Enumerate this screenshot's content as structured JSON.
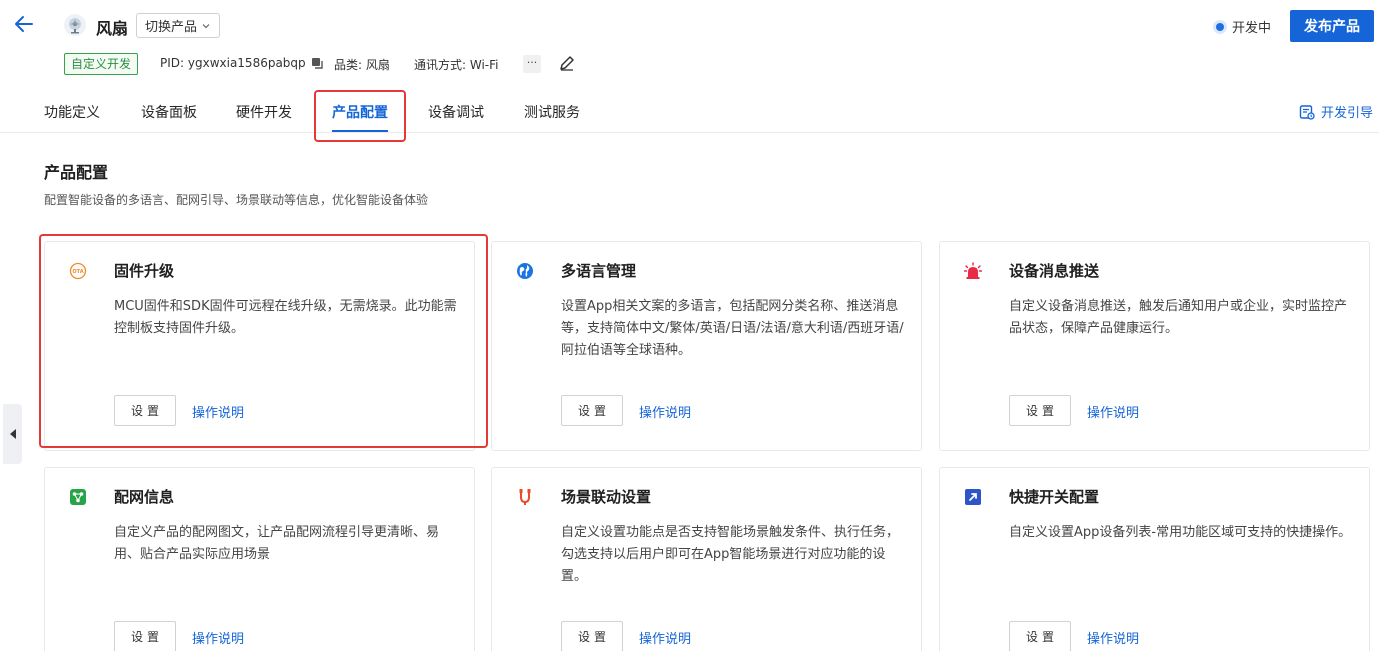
{
  "header": {
    "product_name": "风扇",
    "switch_label": "切换产品",
    "status": "开发中",
    "publish_label": "发布产品",
    "tag": "自定义开发",
    "pid": "PID: ygxwxia1586pabqp",
    "category": "品类: 风扇",
    "comm": "通讯方式: Wi-Fi",
    "more": "···",
    "colors": {
      "primary": "#1565d8",
      "tag_green": "#2c8f3f",
      "highlight": "#e53935"
    }
  },
  "tabs": [
    {
      "label": "功能定义"
    },
    {
      "label": "设备面板"
    },
    {
      "label": "硬件开发"
    },
    {
      "label": "产品配置"
    },
    {
      "label": "设备调试"
    },
    {
      "label": "测试服务"
    }
  ],
  "active_tab": "产品配置",
  "dev_guide": "开发引导",
  "section": {
    "title": "产品配置",
    "desc": "配置智能设备的多语言、配网引导、场景联动等信息，优化智能设备体验"
  },
  "cards": [
    {
      "icon": "ota-icon",
      "title": "固件升级",
      "desc": "MCU固件和SDK固件可远程在线升级，无需烧录。此功能需控制板支持固件升级。",
      "set": "设置",
      "help": "操作说明"
    },
    {
      "icon": "globe-icon",
      "title": "多语言管理",
      "desc": "设置App相关文案的多语言，包括配网分类名称、推送消息等，支持简体中文/繁体/英语/日语/法语/意大利语/西班牙语/阿拉伯语等全球语种。",
      "set": "设置",
      "help": "操作说明"
    },
    {
      "icon": "alarm-icon",
      "title": "设备消息推送",
      "desc": "自定义设备消息推送，触发后通知用户或企业，实时监控产品状态，保障产品健康运行。",
      "set": "设置",
      "help": "操作说明"
    },
    {
      "icon": "network-icon",
      "title": "配网信息",
      "desc": "自定义产品的配网图文，让产品配网流程引导更清晰、易用、贴合产品实际应用场景",
      "set": "设置",
      "help": "操作说明"
    },
    {
      "icon": "scene-icon",
      "title": "场景联动设置",
      "desc": "自定义设置功能点是否支持智能场景触发条件、执行任务，勾选支持以后用户即可在App智能场景进行对应功能的设置。",
      "set": "设置",
      "help": "操作说明"
    },
    {
      "icon": "shortcut-icon",
      "title": "快捷开关配置",
      "desc": "自定义设置App设备列表-常用功能区域可支持的快捷操作。",
      "set": "设置",
      "help": "操作说明"
    }
  ]
}
